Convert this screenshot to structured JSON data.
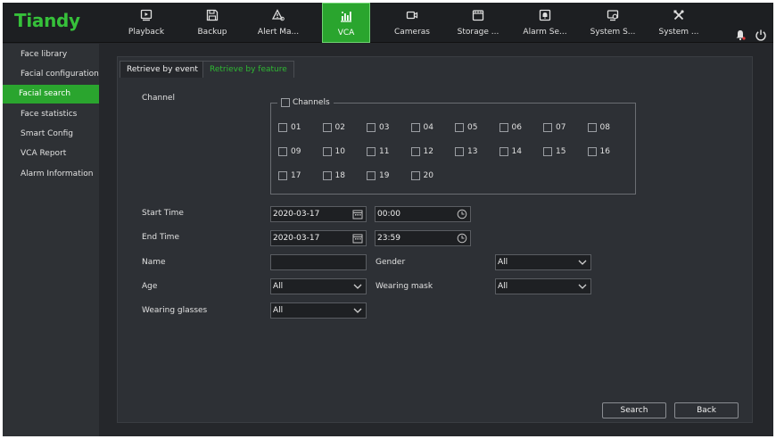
{
  "brand": {
    "logo": "Tiandy",
    "accent": "#2aa52e"
  },
  "topnav": [
    {
      "label": "Playback",
      "icon": "playback-icon",
      "active": false
    },
    {
      "label": "Backup",
      "icon": "save-icon",
      "active": false
    },
    {
      "label": "Alert Ma...",
      "icon": "alert-icon",
      "active": false
    },
    {
      "label": "VCA",
      "icon": "vca-chart-icon",
      "active": true
    },
    {
      "label": "Cameras",
      "icon": "camera-icon",
      "active": false
    },
    {
      "label": "Storage ...",
      "icon": "storage-icon",
      "active": false
    },
    {
      "label": "Alarm Se...",
      "icon": "alarm-settings-icon",
      "active": false
    },
    {
      "label": "System S...",
      "icon": "system-settings-icon",
      "active": false
    },
    {
      "label": "System ...",
      "icon": "tools-icon",
      "active": false
    }
  ],
  "sidebar": {
    "items": [
      {
        "label": "Face library",
        "active": false
      },
      {
        "label": "Facial configuration",
        "active": false
      },
      {
        "label": "Facial search",
        "active": true
      },
      {
        "label": "Face statistics",
        "active": false
      },
      {
        "label": "Smart Config",
        "active": false
      },
      {
        "label": "VCA Report",
        "active": false
      },
      {
        "label": "Alarm Information",
        "active": false
      }
    ]
  },
  "tabs": [
    {
      "label": "Retrieve by event",
      "active": true
    },
    {
      "label": "Retrieve by feature",
      "active": false
    }
  ],
  "form": {
    "channel_label": "Channel",
    "channels_all_label": "Channels",
    "channels": [
      "01",
      "02",
      "03",
      "04",
      "05",
      "06",
      "07",
      "08",
      "09",
      "10",
      "11",
      "12",
      "13",
      "14",
      "15",
      "16",
      "17",
      "18",
      "19",
      "20"
    ],
    "start_time_label": "Start Time",
    "start_date": "2020-03-17",
    "start_time": "00:00",
    "end_time_label": "End Time",
    "end_date": "2020-03-17",
    "end_time": "23:59",
    "name_label": "Name",
    "name_value": "",
    "gender_label": "Gender",
    "gender_value": "All",
    "age_label": "Age",
    "age_value": "All",
    "mask_label": "Wearing mask",
    "mask_value": "All",
    "glasses_label": "Wearing glasses",
    "glasses_value": "All"
  },
  "buttons": {
    "search": "Search",
    "back": "Back"
  }
}
